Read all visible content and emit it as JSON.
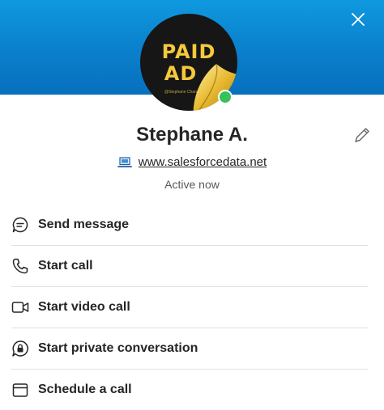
{
  "contact": {
    "avatar_line1": "PAID",
    "avatar_line2": "AD",
    "avatar_small": "@Stephane Chandl",
    "name": "Stephane A.",
    "website": "www.salesforcedata.net",
    "status": "Active now",
    "status_color": "#36c15c"
  },
  "header": {
    "accent": "#0a7fcb"
  },
  "actions": [
    {
      "label": "Send message",
      "icon": "chat-bubble-icon"
    },
    {
      "label": "Start call",
      "icon": "phone-icon"
    },
    {
      "label": "Start video call",
      "icon": "video-camera-icon"
    },
    {
      "label": "Start private conversation",
      "icon": "lock-chat-icon"
    },
    {
      "label": "Schedule a call",
      "icon": "calendar-icon"
    }
  ]
}
